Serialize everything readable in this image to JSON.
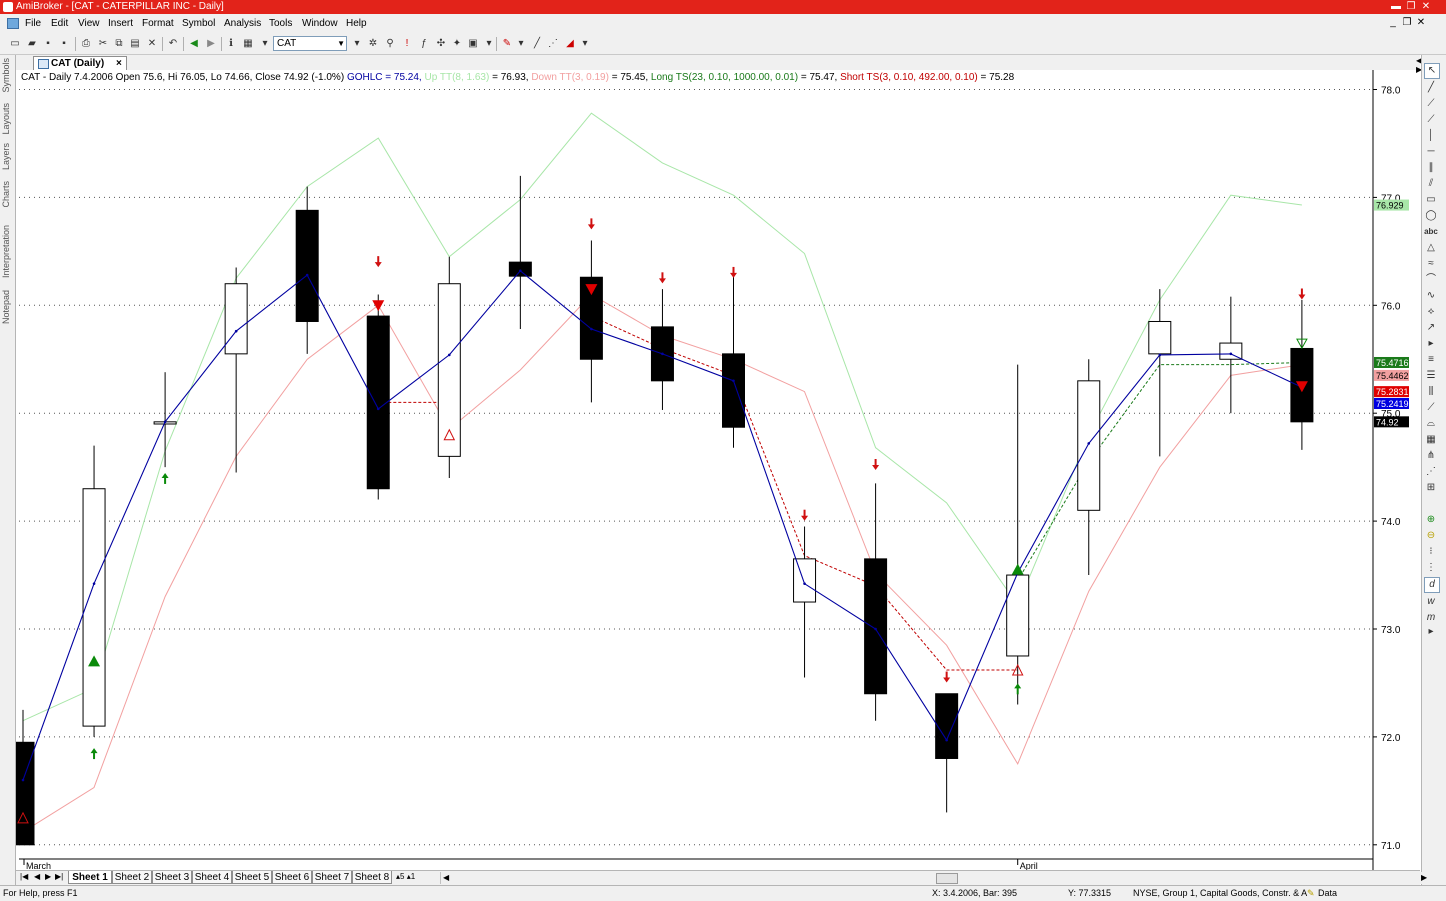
{
  "window": {
    "title": "AmiBroker - [CAT - CATERPILLAR INC - Daily]"
  },
  "menu": [
    "File",
    "Edit",
    "View",
    "Insert",
    "Format",
    "Symbol",
    "Analysis",
    "Tools",
    "Window",
    "Help"
  ],
  "toolbar": {
    "symbol": "CAT"
  },
  "left_tabs": [
    "Symbols",
    "Layouts",
    "Layers",
    "Charts",
    "Interpretation",
    "Notepad"
  ],
  "chart_tab": {
    "label": "CAT (Daily)",
    "close": "×"
  },
  "info": {
    "prefix": "CAT - Daily 7.4.2006 Open 75.6, Hi 76.05, Lo 74.66, Close 74.92 (-1.0%)",
    "gohlc": "GOHLC = 75.24,",
    "up": "Up TT(8, 1.63)",
    "up_val": "= 76.93,",
    "down": "Down TT(3, 0.19)",
    "down_val": "= 75.45,",
    "long": "Long TS(23, 0.10, 1000.00, 0.01)",
    "long_val": "= 75.47,",
    "short": "Short TS(3, 0.10, 492.00, 0.10)",
    "short_val": "= 75.28"
  },
  "colors": {
    "gohlc": "#0000a0",
    "up": "#a8e6a8",
    "down": "#f2a0a0",
    "long": "#1a7a1a",
    "short": "#c00000",
    "buy": "#0a8a0a",
    "sell": "#d01010"
  },
  "chart_data": {
    "type": "candlestick",
    "ylim": [
      70.9,
      78.2
    ],
    "y_ticks": [
      "78.0",
      "77.0",
      "76.0",
      "75.0",
      "74.0",
      "73.0",
      "72.0",
      "71.0"
    ],
    "x_labels": [
      {
        "text": "March",
        "index": 0
      },
      {
        "text": "April",
        "index": 14
      }
    ],
    "candles": [
      {
        "o": 71.95,
        "h": 72.25,
        "l": 71.0,
        "c": 71.0
      },
      {
        "o": 72.1,
        "h": 74.7,
        "l": 72.0,
        "c": 74.3
      },
      {
        "o": 74.9,
        "h": 75.38,
        "l": 74.5,
        "c": 74.92
      },
      {
        "o": 75.55,
        "h": 76.35,
        "l": 74.45,
        "c": 76.2
      },
      {
        "o": 76.88,
        "h": 77.1,
        "l": 75.55,
        "c": 75.85
      },
      {
        "o": 75.9,
        "h": 76.1,
        "l": 74.2,
        "c": 74.3
      },
      {
        "o": 74.6,
        "h": 76.45,
        "l": 74.4,
        "c": 76.2
      },
      {
        "o": 76.4,
        "h": 77.2,
        "l": 75.78,
        "c": 76.27
      },
      {
        "o": 76.26,
        "h": 76.6,
        "l": 75.1,
        "c": 75.5
      },
      {
        "o": 75.8,
        "h": 76.15,
        "l": 75.03,
        "c": 75.3
      },
      {
        "o": 75.55,
        "h": 76.3,
        "l": 74.68,
        "c": 74.87
      },
      {
        "o": 73.25,
        "h": 73.95,
        "l": 72.55,
        "c": 73.65
      },
      {
        "o": 73.65,
        "h": 74.35,
        "l": 72.15,
        "c": 72.4
      },
      {
        "o": 72.4,
        "h": 72.4,
        "l": 71.3,
        "c": 71.8
      },
      {
        "o": 72.75,
        "h": 75.45,
        "l": 72.3,
        "c": 73.5
      },
      {
        "o": 74.1,
        "h": 75.5,
        "l": 73.5,
        "c": 75.3
      },
      {
        "o": 75.55,
        "h": 76.15,
        "l": 74.6,
        "c": 75.85
      },
      {
        "o": 75.5,
        "h": 76.08,
        "l": 75.0,
        "c": 75.65
      },
      {
        "o": 75.6,
        "h": 76.05,
        "l": 74.66,
        "c": 74.92
      }
    ],
    "series": [
      {
        "name": "GOHLC",
        "values": [
          71.6,
          73.42,
          74.92,
          75.76,
          76.28,
          75.04,
          75.54,
          76.32,
          75.78,
          75.55,
          75.3,
          73.42,
          73.0,
          71.97,
          73.52,
          74.72,
          75.54,
          75.55,
          75.24
        ]
      },
      {
        "name": "Up TT(8, 1.63)",
        "values": [
          72.15,
          72.45,
          74.65,
          76.25,
          77.1,
          77.55,
          76.45,
          76.98,
          77.78,
          77.32,
          77.02,
          76.48,
          74.68,
          74.17,
          73.22,
          74.8,
          76.05,
          77.02,
          76.93
        ]
      },
      {
        "name": "Down TT(3, 0.19)",
        "values": [
          71.12,
          71.53,
          73.3,
          74.6,
          75.5,
          76.0,
          74.85,
          75.4,
          76.1,
          75.72,
          75.5,
          75.2,
          73.52,
          72.85,
          71.75,
          73.35,
          74.5,
          75.35,
          75.45
        ]
      },
      {
        "name": "Long TS(23, 0.10, 1000.00, 0.01)",
        "values": [
          null,
          null,
          null,
          null,
          null,
          null,
          null,
          null,
          null,
          null,
          null,
          null,
          null,
          null,
          73.45,
          74.55,
          75.45,
          75.45,
          75.47
        ]
      },
      {
        "name": "Short TS(3, 0.10, 492.00, 0.10)",
        "values": [
          null,
          null,
          null,
          null,
          null,
          75.1,
          75.1,
          null,
          75.9,
          75.6,
          75.35,
          73.68,
          73.4,
          72.62,
          72.62,
          null,
          null,
          null,
          null
        ]
      }
    ],
    "markers": [
      {
        "i": 0,
        "type": "short-hollow",
        "y": 71.25
      },
      {
        "i": 1,
        "type": "buy-filled",
        "y": 72.7
      },
      {
        "i": 1,
        "type": "buy-arrow",
        "y": 71.85
      },
      {
        "i": 2,
        "type": "buy-arrow",
        "y": 74.4
      },
      {
        "i": 5,
        "type": "sell-filled",
        "y": 76.0
      },
      {
        "i": 5,
        "type": "sell-arrow",
        "y": 76.4
      },
      {
        "i": 6,
        "type": "short-hollow",
        "y": 74.8
      },
      {
        "i": 8,
        "type": "sell-filled",
        "y": 76.15
      },
      {
        "i": 8,
        "type": "sell-arrow",
        "y": 76.75
      },
      {
        "i": 9,
        "type": "sell-arrow",
        "y": 76.25
      },
      {
        "i": 10,
        "type": "sell-arrow",
        "y": 76.3
      },
      {
        "i": 11,
        "type": "sell-arrow",
        "y": 74.05
      },
      {
        "i": 12,
        "type": "sell-arrow",
        "y": 74.52
      },
      {
        "i": 13,
        "type": "sell-arrow",
        "y": 72.55
      },
      {
        "i": 14,
        "type": "buy-filled",
        "y": 73.55
      },
      {
        "i": 14,
        "type": "short-hollow",
        "y": 72.62
      },
      {
        "i": 14,
        "type": "buy-arrow",
        "y": 72.45
      },
      {
        "i": 18,
        "type": "sell-arrow",
        "y": 76.1
      },
      {
        "i": 18,
        "type": "long-hollow",
        "y": 75.65
      },
      {
        "i": 18,
        "type": "sell-filled",
        "y": 75.25
      }
    ],
    "value_labels": [
      {
        "text": "76.929",
        "y": 76.929,
        "bg": "#a8e6a8",
        "fg": "#000000"
      },
      {
        "text": "75.4716",
        "y": 75.47,
        "bg": "#1a7a1a",
        "fg": "#ffffff"
      },
      {
        "text": "75.4462",
        "y": 75.35,
        "bg": "#f2a0a0",
        "fg": "#000000"
      },
      {
        "text": "75.2831",
        "y": 75.2,
        "bg": "#e00000",
        "fg": "#ffffff"
      },
      {
        "text": "75.2419",
        "y": 75.09,
        "bg": "#0000e0",
        "fg": "#ffffff"
      },
      {
        "text": "74.92",
        "y": 74.92,
        "bg": "#000000",
        "fg": "#ffffff"
      }
    ]
  },
  "sheets": [
    "Sheet 1",
    "Sheet 2",
    "Sheet 3",
    "Sheet 4",
    "Sheet 5",
    "Sheet 6",
    "Sheet 7",
    "Sheet 8"
  ],
  "status": {
    "help": "For Help, press F1",
    "xinfo": "X: 3.4.2006, Bar: 395",
    "yinfo": "Y: 77.3315",
    "market": "NYSE, Group 1, Capital Goods, Constr. & A",
    "data": "Data"
  }
}
